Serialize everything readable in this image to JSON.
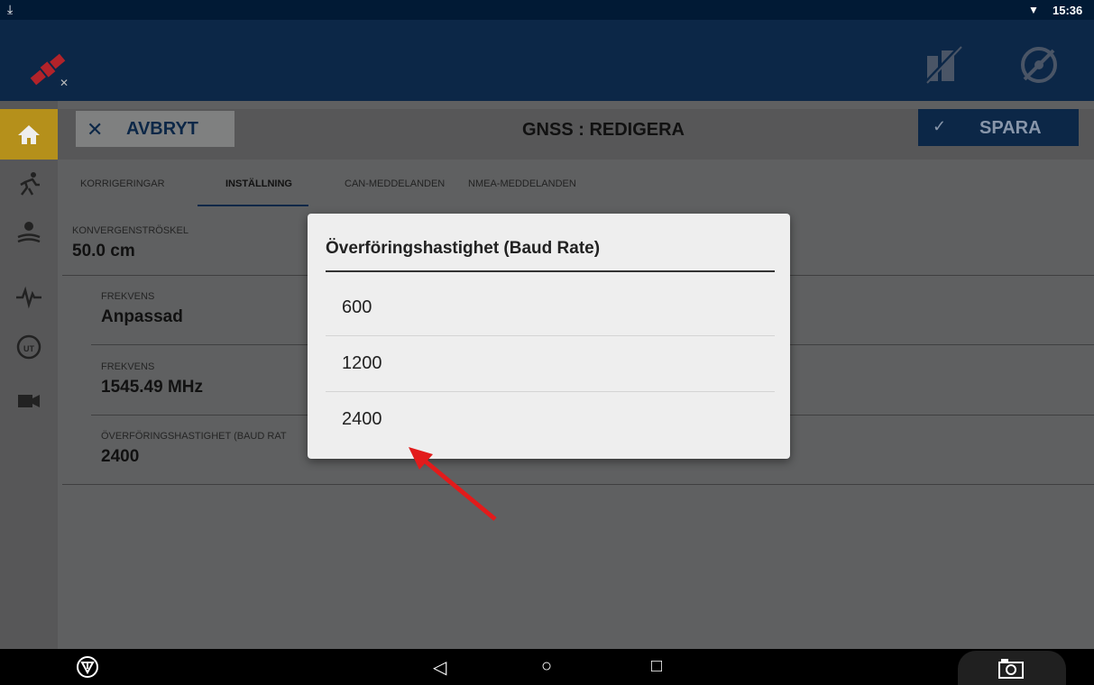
{
  "status_bar": {
    "time": "15:36"
  },
  "header": {
    "cancel_label": "AVBRYT",
    "title": "GNSS : REDIGERA",
    "save_label": "SPARA"
  },
  "tabs": [
    {
      "label": "KORRIGERINGAR",
      "active": false
    },
    {
      "label": "INSTÄLLNING",
      "active": true
    },
    {
      "label": "CAN-MEDDELANDEN",
      "active": false
    },
    {
      "label": "NMEA-MEDDELANDEN",
      "active": false
    }
  ],
  "fields": [
    {
      "label": "KONVERGENSTRÖSKEL",
      "value": "50.0 cm"
    },
    {
      "label": "FREKVENS",
      "value": "Anpassad"
    },
    {
      "label": "FREKVENS",
      "value": "1545.49 MHz"
    },
    {
      "label": "ÖVERFÖRINGSHASTIGHET (BAUD RAT",
      "value": "2400"
    }
  ],
  "dialog": {
    "title": "Överföringshastighet (Baud Rate)",
    "options": [
      "600",
      "1200",
      "2400"
    ]
  },
  "colors": {
    "topbar": "#0c2747",
    "accent": "#b5901b",
    "arrow": "#e21b1b"
  }
}
